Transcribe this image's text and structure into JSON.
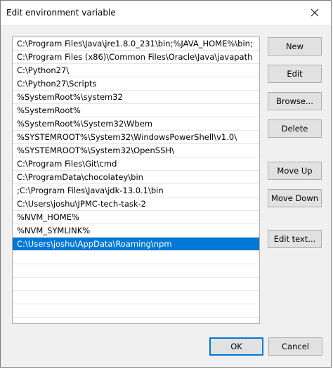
{
  "window": {
    "title": "Edit environment variable"
  },
  "list": {
    "items": [
      "C:\\Program Files\\Java\\jre1.8.0_231\\bin;%JAVA_HOME%\\bin;",
      "C:\\Program Files (x86)\\Common Files\\Oracle\\Java\\javapath",
      "C:\\Python27\\",
      "C:\\Python27\\Scripts",
      "%SystemRoot%\\system32",
      "%SystemRoot%",
      "%SystemRoot%\\System32\\Wbem",
      "%SYSTEMROOT%\\System32\\WindowsPowerShell\\v1.0\\",
      "%SYSTEMROOT%\\System32\\OpenSSH\\",
      "C:\\Program Files\\Git\\cmd",
      "C:\\ProgramData\\chocolatey\\bin",
      ";C:\\Program Files\\Java\\jdk-13.0.1\\bin",
      "C:\\Users\\joshu\\JPMC-tech-task-2",
      "%NVM_HOME%",
      "%NVM_SYMLINK%",
      "C:\\Users\\joshu\\AppData\\Roaming\\npm"
    ],
    "selected_index": 15
  },
  "buttons": {
    "new": "New",
    "edit": "Edit",
    "browse": "Browse...",
    "delete": "Delete",
    "move_up": "Move Up",
    "move_down": "Move Down",
    "edit_text": "Edit text...",
    "ok": "OK",
    "cancel": "Cancel"
  },
  "colors": {
    "selection": "#0078d7",
    "button_face": "#e1e1e1",
    "dialog_bg": "#f0f0f0"
  }
}
